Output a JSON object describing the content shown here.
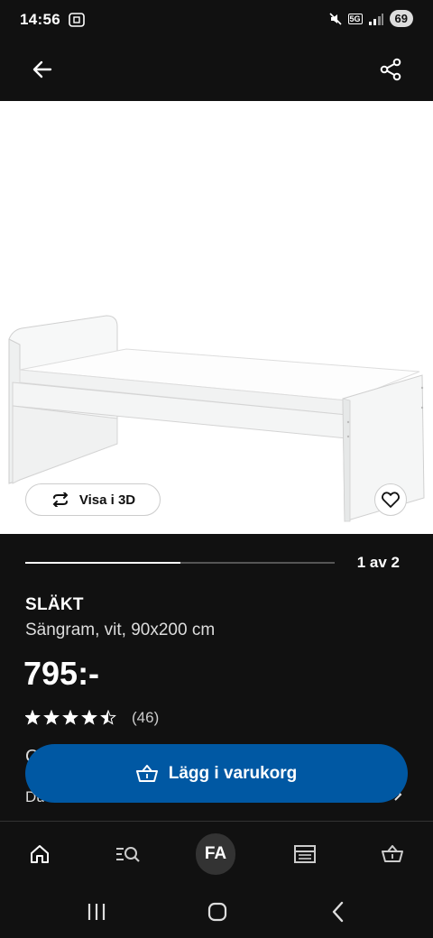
{
  "status_bar": {
    "time": "14:56",
    "network_label": "5G",
    "battery": "69"
  },
  "icons": {
    "back": "arrow-left-icon",
    "share": "share-icon",
    "rotate": "rotate-3d-icon",
    "favorite": "heart-icon",
    "cart": "basket-icon",
    "home": "home-icon",
    "search": "search-icon",
    "store": "store-icon",
    "basket": "basket-icon"
  },
  "product": {
    "view_3d_label": "Visa i 3D",
    "carousel_counter": "1 av 2",
    "carousel_progress": 0.5,
    "name": "SLÄKT",
    "description": "Sängram, vit, 90x200 cm",
    "price": "795:-",
    "rating": 4.5,
    "rating_count": "(46)",
    "partial_text_1": "C",
    "partial_text_2": "Du"
  },
  "cart_button": {
    "label": "Lägg i varukorg"
  },
  "bottom_nav": {
    "profile_initials": "FA"
  },
  "colors": {
    "background": "#111111",
    "primary_button": "#0058a3",
    "text": "#ffffff"
  }
}
